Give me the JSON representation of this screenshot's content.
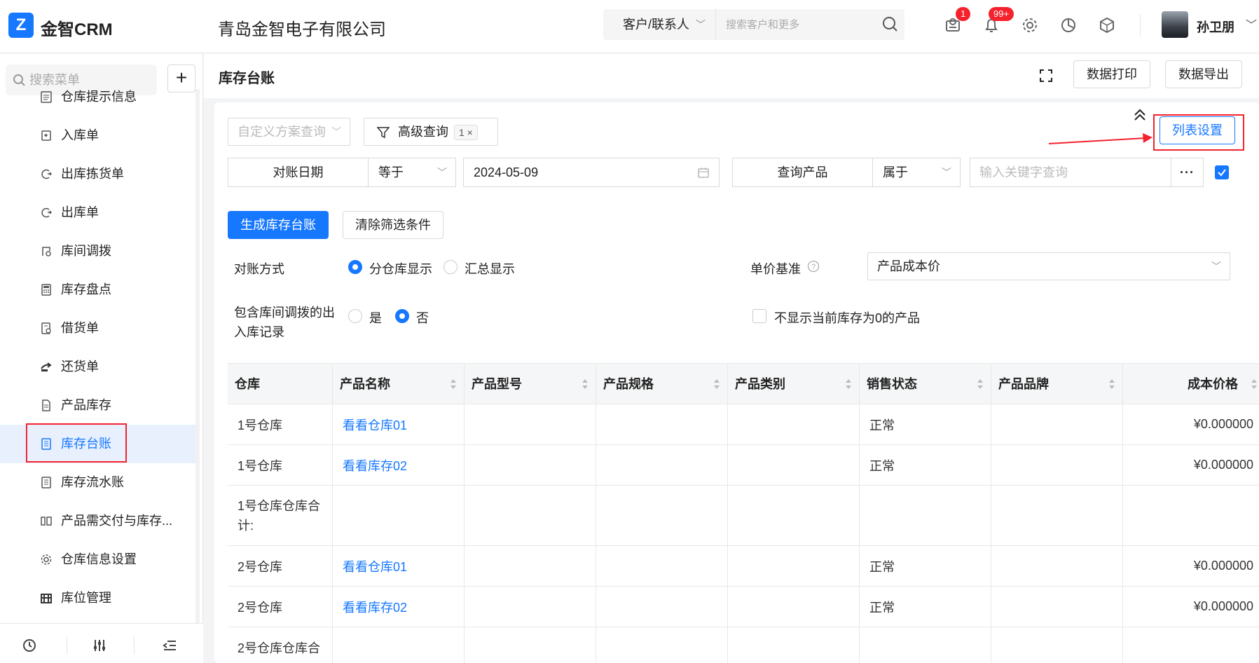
{
  "topbar": {
    "logo_mark": "Z",
    "logo_text": "金智CRM",
    "company": "青岛金智电子有限公司",
    "search_type": "客户/联系人",
    "search_placeholder": "搜索客户和更多",
    "messages_badge": "1",
    "notifications_badge": "99+",
    "user_name": "孙卫朋"
  },
  "sidebar": {
    "search_placeholder": "搜索菜单",
    "add_label": "+",
    "items": [
      {
        "label": "仓库提示信息",
        "icon": "list-icon"
      },
      {
        "label": "入库单",
        "icon": "inbound-icon"
      },
      {
        "label": "出库拣货单",
        "icon": "picking-icon"
      },
      {
        "label": "出库单",
        "icon": "outbound-icon"
      },
      {
        "label": "库间调拨",
        "icon": "transfer-icon"
      },
      {
        "label": "库存盘点",
        "icon": "calculator-icon"
      },
      {
        "label": "借货单",
        "icon": "borrow-icon"
      },
      {
        "label": "还货单",
        "icon": "return-icon"
      },
      {
        "label": "产品库存",
        "icon": "document-icon"
      },
      {
        "label": "库存台账",
        "icon": "ledger-icon",
        "active": true
      },
      {
        "label": "库存流水账",
        "icon": "journal-icon"
      },
      {
        "label": "产品需交付与库存...",
        "icon": "compare-icon"
      },
      {
        "label": "仓库信息设置",
        "icon": "settings-icon"
      },
      {
        "label": "库位管理",
        "icon": "location-icon"
      }
    ]
  },
  "page": {
    "title": "库存台账",
    "print_button": "数据打印",
    "export_button": "数据导出"
  },
  "filters": {
    "scheme_placeholder": "自定义方案查询",
    "advanced_query": "高级查询",
    "advanced_count": "1",
    "list_settings": "列表设置",
    "date_field": "对账日期",
    "date_operator": "等于",
    "date_value": "2024-05-09",
    "product_field": "查询产品",
    "product_operator": "属于",
    "keyword_placeholder": "输入关键字查询",
    "more": "···",
    "generate_button": "生成库存台账",
    "clear_button": "清除筛选条件",
    "recon_label": "对账方式",
    "recon_option_1": "分仓库显示",
    "recon_option_2": "汇总显示",
    "price_label": "单价基准",
    "price_value": "产品成本价",
    "transfer_label_line1": "包含库间调拨的出",
    "transfer_label_line2": "入库记录",
    "transfer_yes": "是",
    "transfer_no": "否",
    "hide_zero_label": "不显示当前库存为0的产品"
  },
  "table": {
    "columns": [
      "仓库",
      "产品名称",
      "产品型号",
      "产品规格",
      "产品类别",
      "销售状态",
      "产品品牌",
      "成本价格"
    ],
    "rows": [
      {
        "warehouse": "1号仓库",
        "product": "看看仓库01",
        "status": "正常",
        "cost": "¥0.000000"
      },
      {
        "warehouse": "1号仓库",
        "product": "看看库存02",
        "status": "正常",
        "cost": "¥0.000000"
      },
      {
        "warehouse": "1号仓库仓库合计:",
        "product": "",
        "status": "",
        "cost": ""
      },
      {
        "warehouse": "2号仓库",
        "product": "看看仓库01",
        "status": "正常",
        "cost": "¥0.000000"
      },
      {
        "warehouse": "2号仓库",
        "product": "看看库存02",
        "status": "正常",
        "cost": "¥0.000000"
      },
      {
        "warehouse": "2号仓库仓库合",
        "product": "",
        "status": "",
        "cost": ""
      }
    ]
  },
  "colors": {
    "primary": "#1677ff",
    "annotation": "#f5222d",
    "badge": "#f5222d"
  }
}
